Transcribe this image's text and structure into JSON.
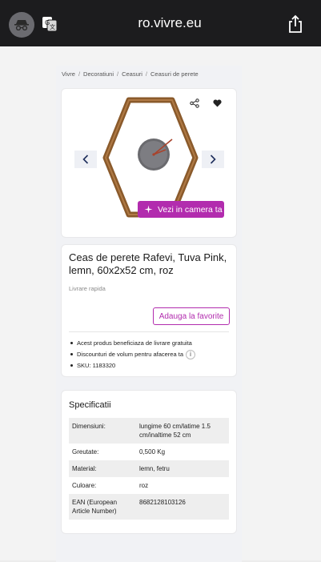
{
  "browser": {
    "url": "ro.vivre.eu",
    "left_icons": [
      "incognito-icon",
      "translate-icon"
    ],
    "right_icon": "share-icon"
  },
  "breadcrumb": {
    "items": [
      "Vivre",
      "Decoratiuni",
      "Ceasuri",
      "Ceasuri de perete"
    ],
    "separator": "/"
  },
  "product": {
    "title": "Ceas de perete Rafevi, Tuva Pink, lemn, 60x2x52 cm, roz",
    "delivery": "Livrare rapida",
    "favorite_label": "Adauga la favorite",
    "camera_label": "Vezi in camera ta",
    "bullets": [
      "Acest produs beneficiaza de livrare gratuita",
      "Discounturi de volum pentru afacerea ta",
      "SKU: 1183320"
    ],
    "accent_color": "#b22cae"
  },
  "specs": {
    "title": "Specificatii",
    "rows": [
      {
        "key": "Dimensiuni:",
        "value": "lungime 60 cm/latime 1.5 cm/inaltime 52 cm"
      },
      {
        "key": "Greutate:",
        "value": "0,500 Kg"
      },
      {
        "key": "Material:",
        "value": "lemn, fetru"
      },
      {
        "key": "Culoare:",
        "value": "roz"
      },
      {
        "key": "EAN (European Article Number)",
        "value": "8682128103126"
      }
    ]
  }
}
